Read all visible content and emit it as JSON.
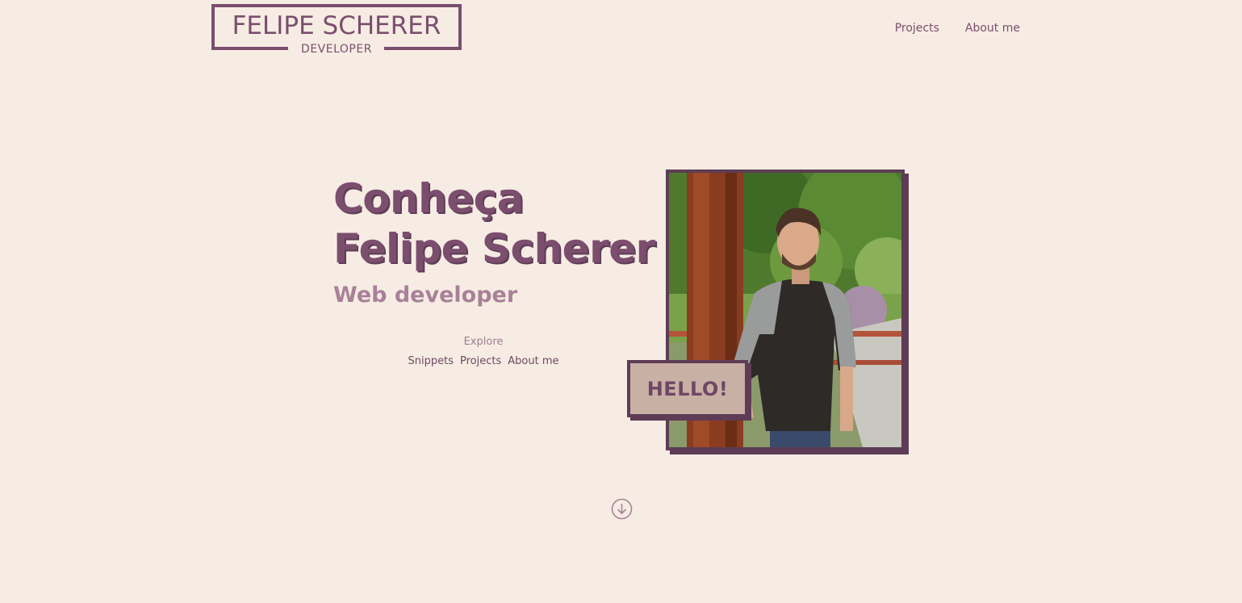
{
  "header": {
    "logo_name": "FELIPE SCHERER",
    "logo_sub": "DEVELOPER",
    "nav": [
      {
        "label": "Projects"
      },
      {
        "label": "About me"
      }
    ]
  },
  "hero": {
    "title_line1": "Conheça",
    "title_line2": "Felipe Scherer",
    "subtitle": "Web developer",
    "explore_label": "Explore",
    "explore_links": [
      {
        "label": "Snippets"
      },
      {
        "label": "Projects"
      },
      {
        "label": "About me"
      }
    ],
    "hello_label": "HELLO!"
  },
  "colors": {
    "background": "#f6ece3",
    "primary": "#7b4e6e",
    "dark": "#5e3c56",
    "muted": "#a88198",
    "hello_bg": "#c9b0a5"
  },
  "icons": {
    "scroll": "arrow-down-circle-icon"
  }
}
